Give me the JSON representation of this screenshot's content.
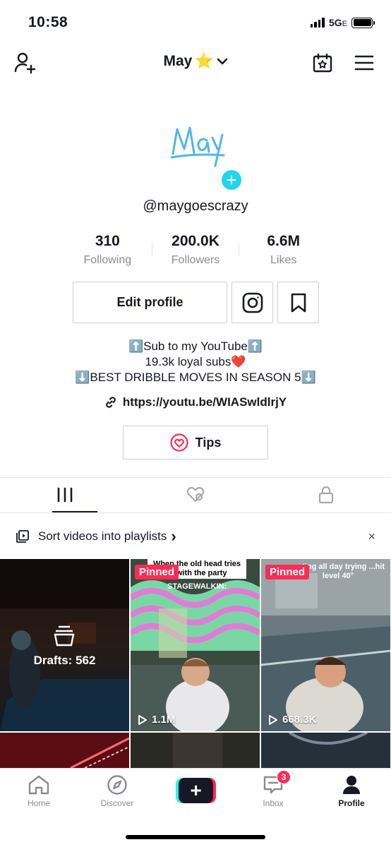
{
  "status_bar": {
    "time": "10:58",
    "network": "5G",
    "network_suffix": "E"
  },
  "header": {
    "title": "May",
    "title_emoji": "⭐"
  },
  "profile": {
    "avatar_text": "May",
    "username": "@maygoescrazy",
    "stats": [
      {
        "value": "310",
        "label": "Following"
      },
      {
        "value": "200.0K",
        "label": "Followers"
      },
      {
        "value": "6.6M",
        "label": "Likes"
      }
    ],
    "edit_label": "Edit profile",
    "bio_lines": [
      "⬆️Sub to my YouTube⬆️",
      "19.3k loyal subs❤️",
      "⬇️BEST DRIBBLE MOVES IN SEASON 5⬇️"
    ],
    "link": "https://youtu.be/WIASwldlrjY",
    "tips_label": "Tips"
  },
  "playlist_banner": {
    "label": "Sort videos into playlists",
    "chevron": "›",
    "close": "×"
  },
  "videos": [
    {
      "type": "drafts",
      "label": "Drafts: 562"
    },
    {
      "pinned": "Pinned",
      "views": "1.1M",
      "caption": "When the old head tries to with the party",
      "caption2": "STAGEWALKIN:"
    },
    {
      "pinned": "Pinned",
      "views": "668.3K",
      "caption": "...sting all day trying ...hit level 40°"
    }
  ],
  "bottom_nav": {
    "home": "Home",
    "discover": "Discover",
    "inbox": "Inbox",
    "inbox_badge": "3",
    "profile": "Profile",
    "create": "+"
  },
  "colors": {
    "accent": "#fe2c55",
    "cyan": "#20d5ec",
    "avatar_text": "#4fb7e6"
  }
}
